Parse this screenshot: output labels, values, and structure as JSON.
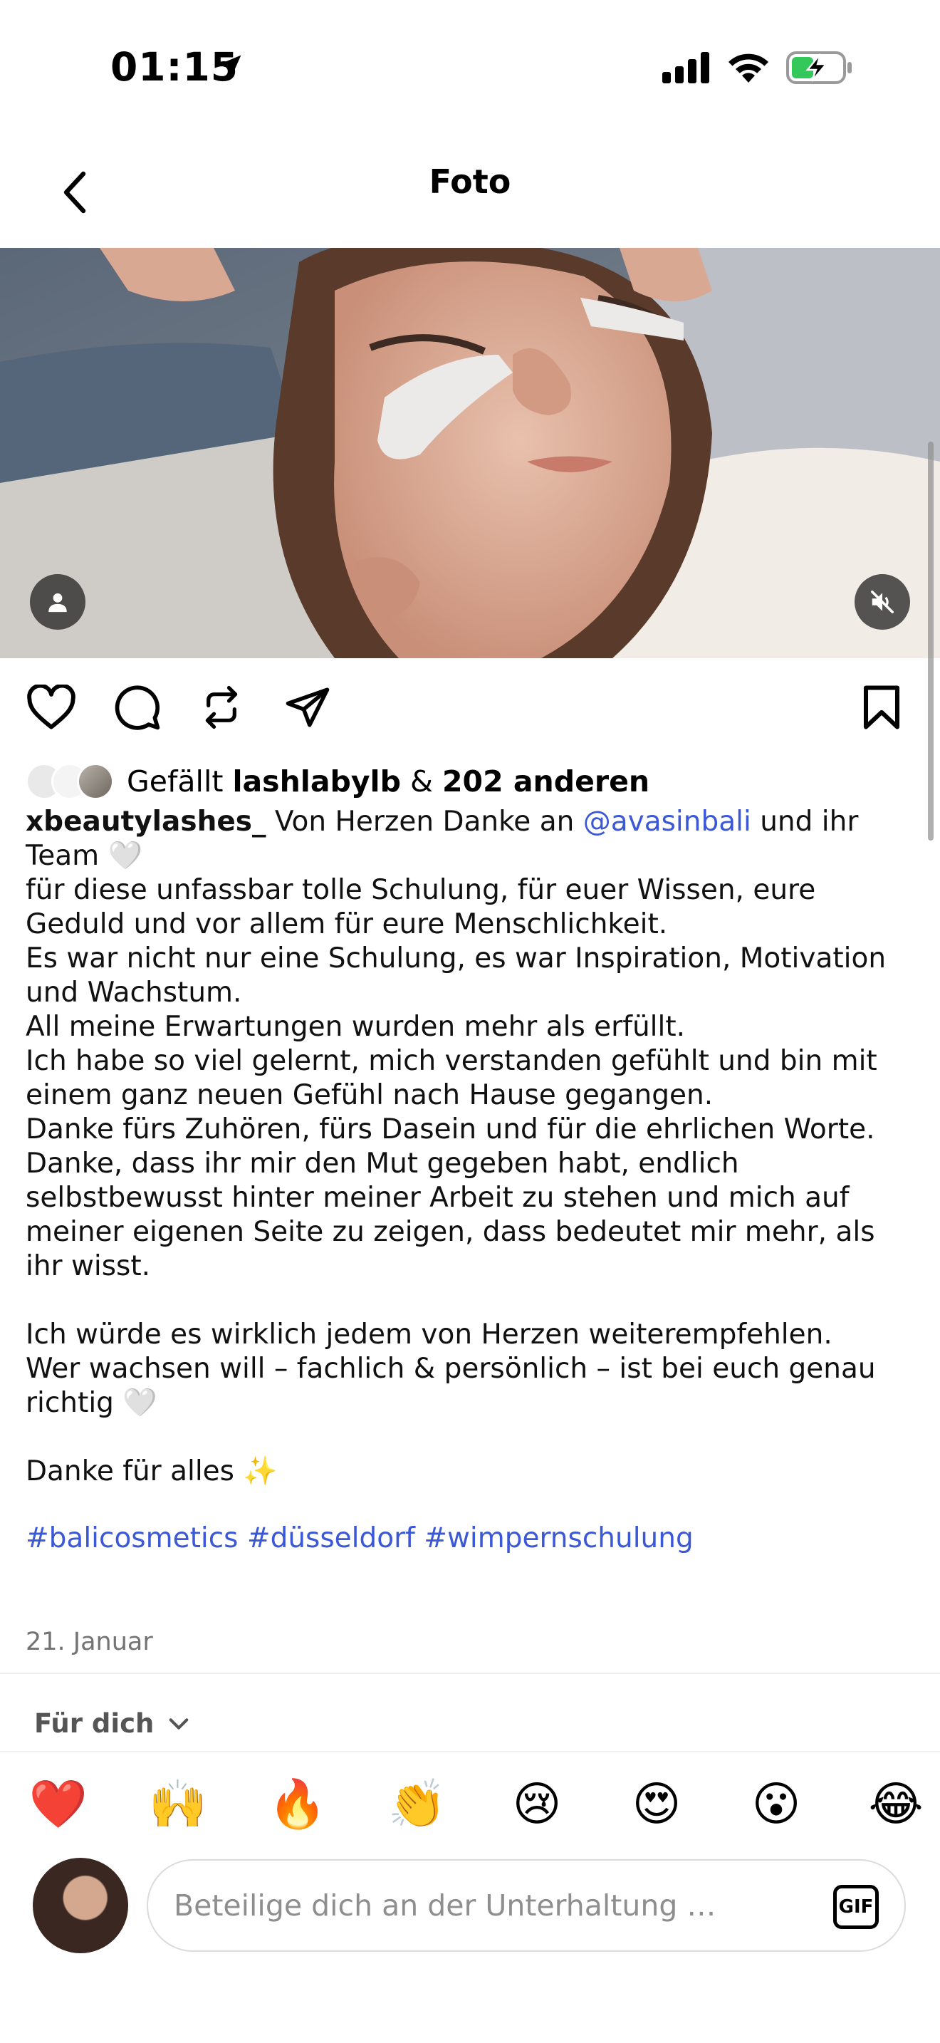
{
  "status_bar": {
    "time": "01:15",
    "icons": [
      "location-arrow-icon",
      "cellular-signal-icon",
      "wifi-icon",
      "battery-charging-icon"
    ],
    "battery_color": "#34c759"
  },
  "header": {
    "title": "Foto",
    "back_icon": "chevron-left-icon"
  },
  "post": {
    "actions": [
      "heart-icon",
      "comment-icon",
      "repost-icon",
      "share-icon",
      "bookmark-icon"
    ],
    "likes": {
      "prefix": "Gefällt ",
      "user": "lashlabylb",
      "middle": " & ",
      "others": "202 anderen"
    },
    "caption": {
      "username": "xbeautylashes_",
      "intro": " Von Herzen Danke an ",
      "mention": "@avasinbali",
      "after_mention": " und ihr Team 🤍",
      "lines": [
        "für diese unfassbar tolle Schulung, für euer Wissen, eure Geduld und vor allem für eure Menschlichkeit.",
        "Es war nicht nur eine Schulung, es war Inspiration, Motivation und Wachstum.",
        "All meine Erwartungen wurden mehr als erfüllt.",
        "Ich habe so viel gelernt, mich verstanden gefühlt und bin mit einem ganz neuen Gefühl nach Hause gegangen.",
        "Danke fürs Zuhören, fürs Dasein und für die ehrlichen Worte.",
        "Danke, dass ihr mir den Mut gegeben habt, endlich selbstbewusst hinter meiner Arbeit zu stehen und mich auf meiner eigenen Seite zu zeigen, dass bedeutet mir mehr, als ihr wisst."
      ],
      "lines2": [
        "Ich würde es wirklich jedem von Herzen weiterempfehlen.",
        "Wer wachsen will – fachlich & persönlich – ist bei euch genau richtig 🤍"
      ],
      "closing": "Danke für alles ✨",
      "hashtags": "#balicosmetics #düsseldorf #wimpernschulung"
    },
    "date": "21. Januar"
  },
  "comments": {
    "filter_label": "Für dich",
    "reactions": [
      "❤️",
      "🙌",
      "🔥",
      "👏",
      "😢",
      "😍",
      "😮",
      "😂"
    ],
    "input_placeholder": "Beteilige dich an der Unterhaltung …",
    "gif_label": "GIF"
  }
}
